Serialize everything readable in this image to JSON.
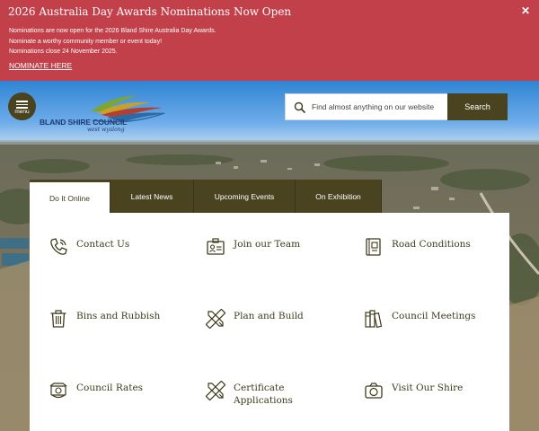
{
  "alert": {
    "title": "2026 Australia Day Awards Nominations Now Open",
    "close_glyph": "✕",
    "lines": [
      "Nominations are now open for the 2026 Bland Shire Australia Day Awards.",
      "Nominate a worthy community member or event today!",
      "Nominations close 24 November 2025."
    ],
    "link_label": "NOMINATE HERE",
    "background": "#c2404a"
  },
  "header": {
    "menu_label": "menu",
    "logo_name": "BLAND SHIRE COUNCIL",
    "logo_tagline": "west wyalong"
  },
  "search": {
    "placeholder": "Find almost anything on our website",
    "button_label": "Search"
  },
  "tabs": [
    {
      "label": "Do It Online",
      "active": true
    },
    {
      "label": "Latest News",
      "active": false
    },
    {
      "label": "Upcoming Events",
      "active": false
    },
    {
      "label": "On Exhibition",
      "active": false
    }
  ],
  "quick_links": [
    {
      "label": "Contact Us",
      "icon": "phone-icon"
    },
    {
      "label": "Join our Team",
      "icon": "id-card-icon"
    },
    {
      "label": "Road Conditions",
      "icon": "road-sign-icon"
    },
    {
      "label": "Bins and Rubbish",
      "icon": "bin-icon"
    },
    {
      "label": "Plan and Build",
      "icon": "pencil-ruler-icon"
    },
    {
      "label": "Council Meetings",
      "icon": "books-icon"
    },
    {
      "label": "Council Rates",
      "icon": "rates-icon"
    },
    {
      "label": "Certificate Applications",
      "icon": "pencil-ruler-icon"
    },
    {
      "label": "Visit Our Shire",
      "icon": "camera-icon"
    }
  ],
  "colors": {
    "brand_olive": "#4a4320",
    "alert_red": "#c2404a",
    "text_dark": "#3f3b1c",
    "logo_blue": "#233a73"
  }
}
